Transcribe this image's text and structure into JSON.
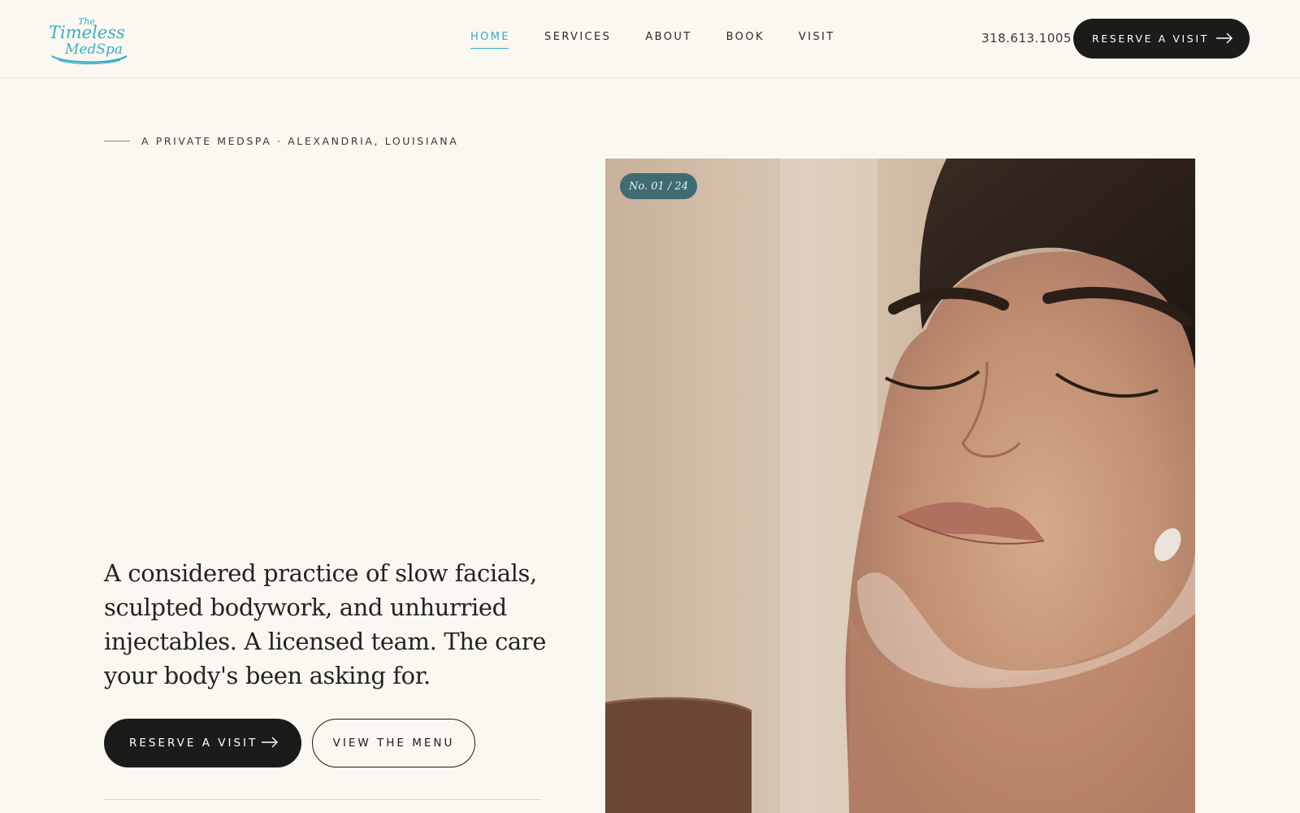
{
  "brand": {
    "name": "The Timeless MedSpa",
    "logo_line1": "The",
    "logo_line2": "Timeless",
    "logo_line3": "MedSpa",
    "accent_color": "#38aec9"
  },
  "nav": {
    "items": [
      {
        "label": "HOME",
        "active": true
      },
      {
        "label": "SERVICES",
        "active": false
      },
      {
        "label": "ABOUT",
        "active": false
      },
      {
        "label": "BOOK",
        "active": false
      },
      {
        "label": "VISIT",
        "active": false
      }
    ]
  },
  "header": {
    "phone": "318.613.1005",
    "cta_label": "RESERVE A VISIT",
    "cta_icon": "arrow-right-icon"
  },
  "hero": {
    "eyebrow": "A PRIVATE MEDSPA · ALEXANDRIA, LOUISIANA",
    "copy": "A considered practice of slow facials, sculpted bodywork, and unhurried injectables. A licensed team. The care your body's been asking for.",
    "primary_cta": "RESERVE A VISIT",
    "secondary_cta": "VIEW THE MENU",
    "image_badge": "No. 01 / 24"
  },
  "colors": {
    "background": "#faf8f1",
    "dark": "#1b1b1a",
    "badge": "#3e6c72"
  }
}
